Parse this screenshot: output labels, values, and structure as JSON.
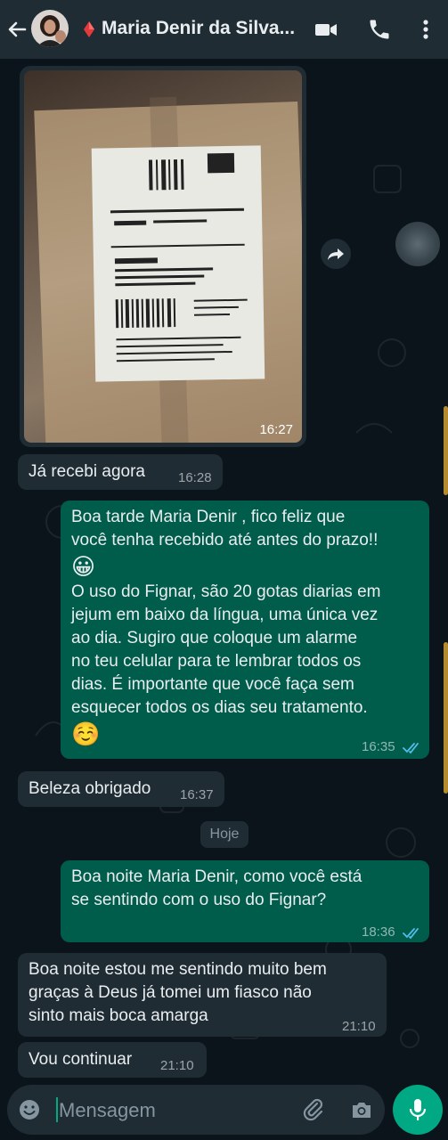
{
  "header": {
    "contact_name": "Maria Denir da Silva...",
    "back_icon": "arrow-left-icon",
    "video_icon": "video-call-icon",
    "phone_icon": "phone-icon",
    "menu_icon": "more-vertical-icon"
  },
  "colors": {
    "header_bg": "#1f2c34",
    "chat_bg": "#0b141a",
    "incoming_bubble": "#1f2c34",
    "outgoing_bubble": "#005c4b",
    "accent": "#00a884",
    "read_ticks": "#53bdeb"
  },
  "messages": [
    {
      "type": "image",
      "direction": "in",
      "time": "16:27"
    },
    {
      "direction": "in",
      "text": "Já recebi  agora",
      "time": "16:28"
    },
    {
      "direction": "out",
      "lines": [
        "Boa tarde Maria Denir ,   fico  feliz que",
        "você tenha recebido até antes do prazo!!",
        "😀",
        "O uso do Fignar, são 20 gotas diarias em",
        "jejum em baixo da língua, uma única vez",
        "ao dia.  Sugiro que coloque um alarme",
        "no teu celular para te lembrar todos os",
        "dias. É importante que você faça sem",
        "esquecer todos os dias seu tratamento.",
        "☺️"
      ],
      "time": "16:35",
      "status": "read"
    },
    {
      "direction": "in",
      "text": "Beleza obrigado",
      "time": "16:37"
    },
    {
      "type": "date",
      "text": "Hoje"
    },
    {
      "direction": "out",
      "lines": [
        "Boa noite Maria Denir, como você está",
        "se sentindo com o uso do Fignar?"
      ],
      "time": "18:36",
      "status": "read"
    },
    {
      "direction": "in",
      "lines": [
        "Boa noite  estou  me sentindo muito bem",
        "graças à Deus  já tomei  um  fiasco não",
        "sinto mais  boca amarga"
      ],
      "time": "21:10"
    },
    {
      "direction": "in",
      "text": "Vou continuar",
      "time": "21:10"
    }
  ],
  "input": {
    "placeholder": "Mensagem",
    "emoji_icon": "emoji-icon",
    "attach_icon": "paperclip-icon",
    "camera_icon": "camera-icon",
    "mic_icon": "microphone-icon"
  },
  "image_actions": {
    "forward_icon": "forward-icon",
    "scroll_icon": "scroll-down-icon"
  }
}
